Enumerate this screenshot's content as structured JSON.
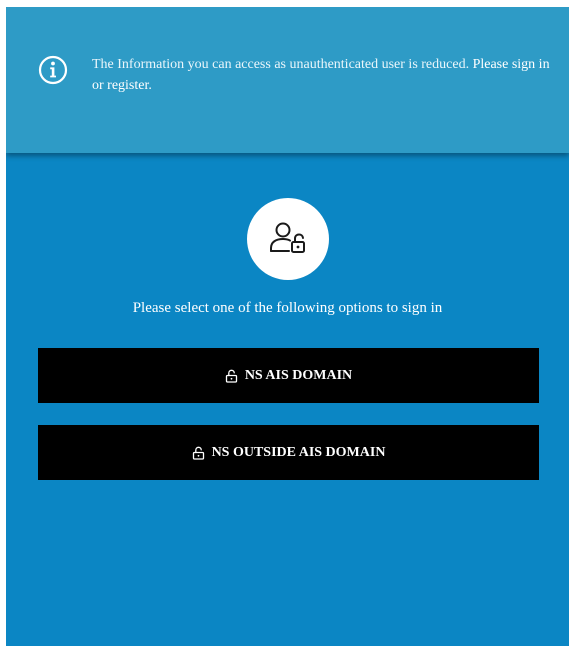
{
  "banner": {
    "icon": "info-circle-icon",
    "message": "The Information you can access as unauthenticated user is reduced.",
    "action_text": "Please sign in or register."
  },
  "login": {
    "avatar_icon": "user-unlock-icon",
    "prompt": "Please select one of the following options to sign in",
    "options": [
      {
        "label": "NS AIS DOMAIN",
        "icon": "lock-open-icon"
      },
      {
        "label": "NS OUTSIDE AIS DOMAIN",
        "icon": "lock-open-icon"
      }
    ]
  },
  "colors": {
    "background": "#0b86c4",
    "banner": "#2e9bc6",
    "button": "#000000",
    "text": "#ffffff"
  }
}
